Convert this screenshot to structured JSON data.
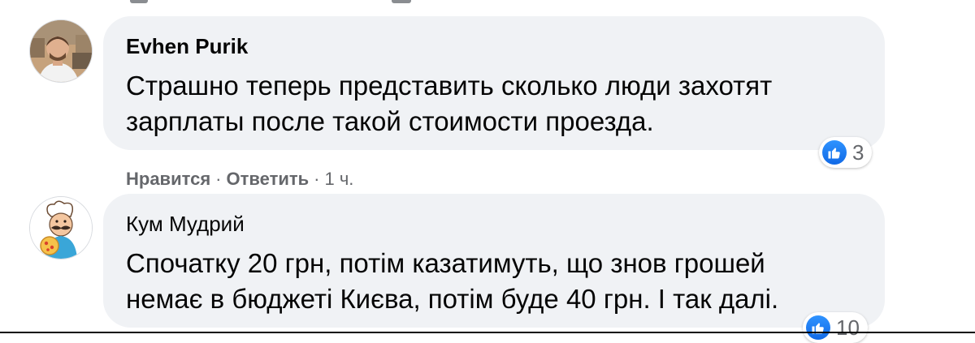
{
  "comments": [
    {
      "author": "Evhen Purik",
      "text_lines": [
        "Страшно теперь представить сколько люди захотят",
        "зарплаты после такой стоимости проезда."
      ],
      "reaction_count": "3",
      "actions": {
        "like": "Нравится",
        "reply": "Ответить",
        "separator": "·",
        "time": "1 ч."
      }
    },
    {
      "author": "Кум Мудрий",
      "text_lines": [
        "Спочатку 20 грн, потім казатимуть, що знов грошей",
        "немає в бюджеті Києва, потім буде 40 грн. І так далі."
      ],
      "reaction_count": "10"
    }
  ],
  "icons": {
    "reaction": "like-icon",
    "reaction_color": "#1877f2"
  },
  "colors": {
    "bubble": "#f0f2f5",
    "text": "#050505",
    "muted": "#65676b"
  }
}
